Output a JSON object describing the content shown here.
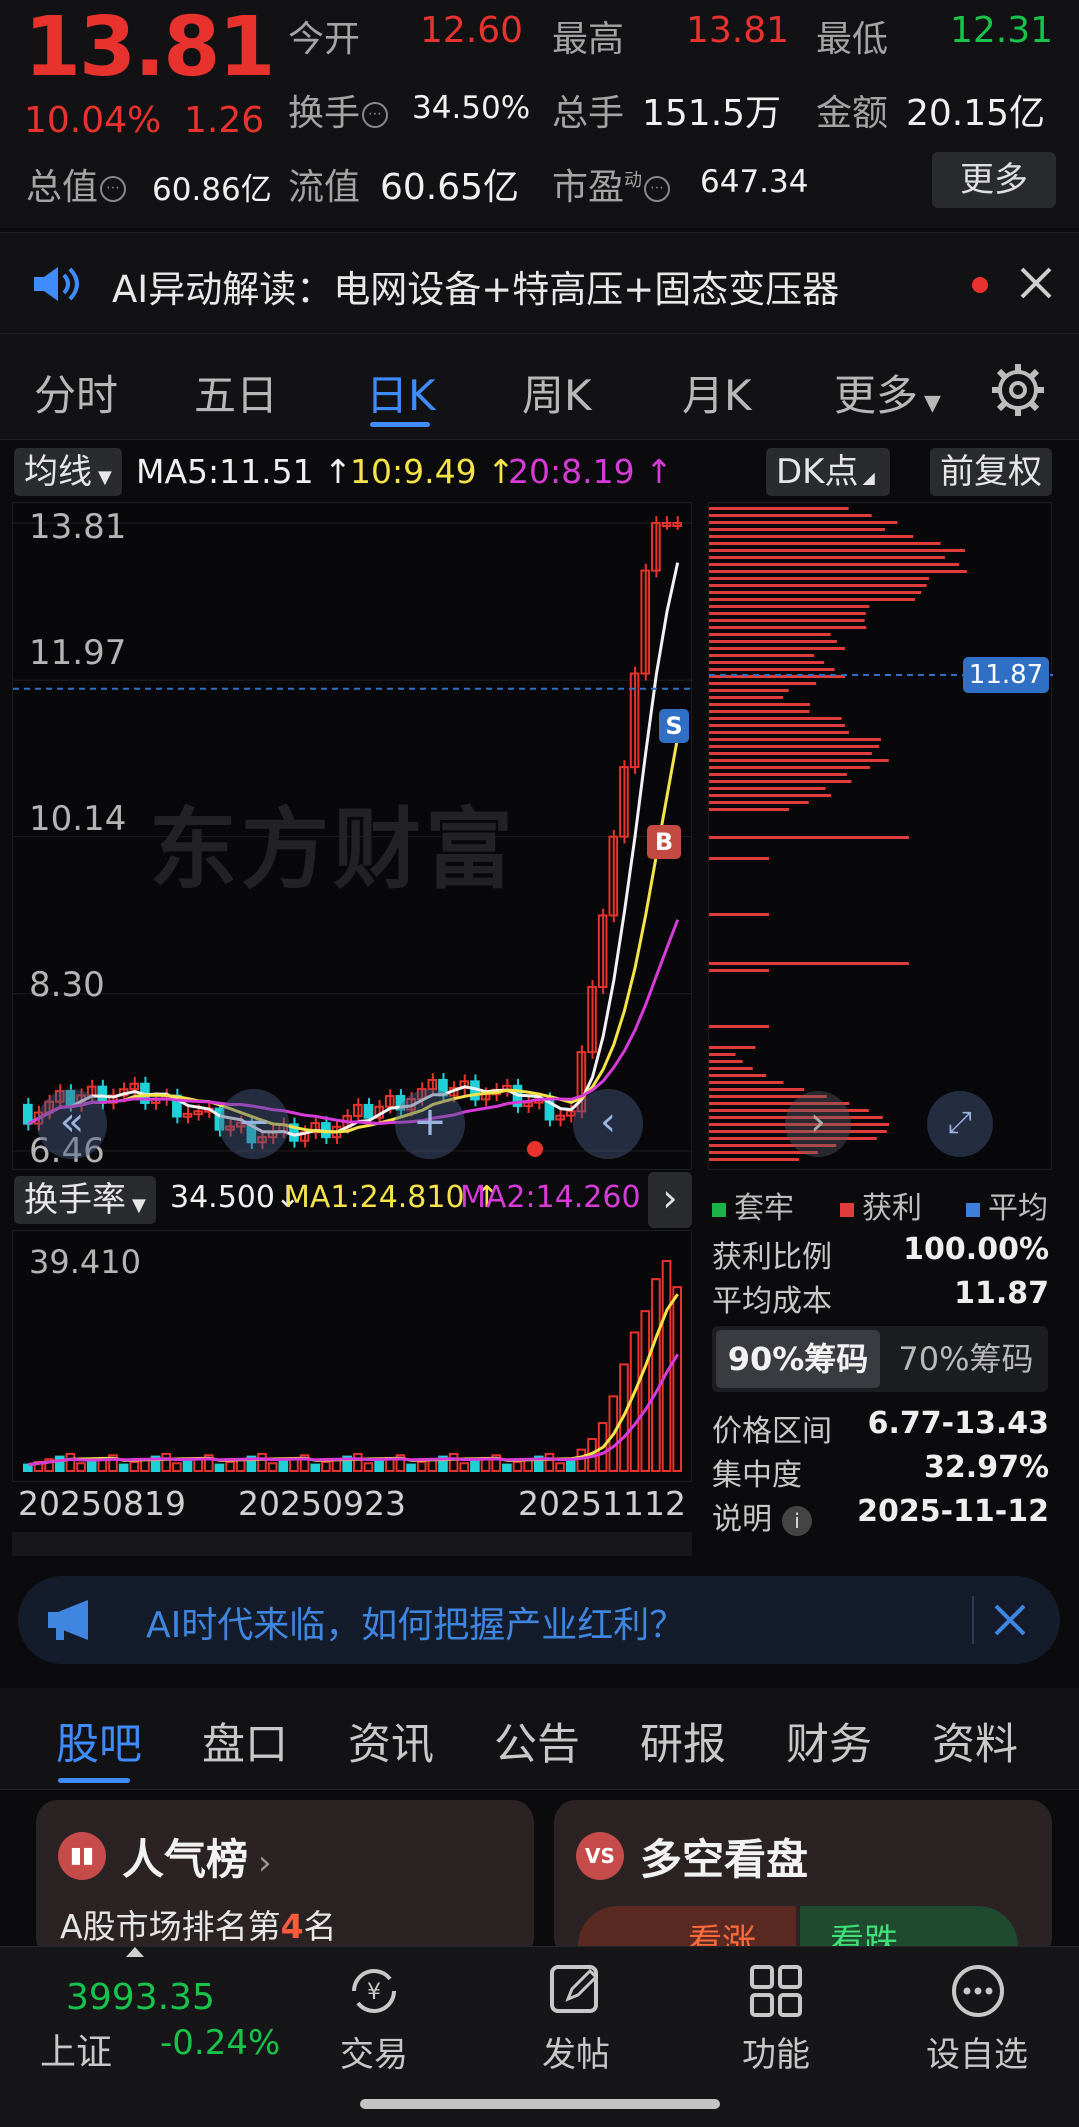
{
  "quote": {
    "price": "13.81",
    "change_pct": "10.04%",
    "change_amt": "1.26",
    "open_label": "今开",
    "open": "12.60",
    "high_label": "最高",
    "high": "13.81",
    "low_label": "最低",
    "low": "12.31",
    "turnover_label": "换手",
    "turnover": "34.50%",
    "volume_label": "总手",
    "volume": "151.5万",
    "amount_label": "金额",
    "amount": "20.15亿",
    "mktcap_label": "总值",
    "mktcap": "60.86亿",
    "float_label": "流值",
    "float_cap": "60.65亿",
    "pe_label": "市盈",
    "pe_sup": "动",
    "pe": "647.34",
    "more": "更多"
  },
  "ai_bar": {
    "text": "AI异动解读：电网设备+特高压+固态变压器"
  },
  "tabs": [
    {
      "label": "分时"
    },
    {
      "label": "五日"
    },
    {
      "label": "日K"
    },
    {
      "label": "周K"
    },
    {
      "label": "月K"
    },
    {
      "label": "更多"
    }
  ],
  "indicators": {
    "ma_select": "均线",
    "ma5": "MA5:11.51",
    "ma10": "10:9.49",
    "ma20": "20:8.19",
    "dk": "DK点",
    "adjust": "前复权",
    "turn_select": "换手率",
    "turn_val": "34.500",
    "turn_ma1": "MA1:24.810",
    "turn_ma2": "MA2:14.260"
  },
  "kchart": {
    "y_labels": [
      "13.81",
      "11.97",
      "10.14",
      "8.30",
      "6.46"
    ],
    "cost_tag": "11.87",
    "marker_s": "S",
    "marker_b": "B",
    "watermark": "东方财富"
  },
  "volchart": {
    "y_max": "39.410"
  },
  "dates": [
    "20250819",
    "20250923",
    "20251112"
  ],
  "chips": {
    "legend": [
      "套牢",
      "获利",
      "平均"
    ],
    "legend_colors": [
      "#19b347",
      "#e03c3c",
      "#3f7fdc"
    ],
    "profit_ratio_label": "获利比例",
    "profit_ratio": "100.00%",
    "avg_cost_label": "平均成本",
    "avg_cost": "11.87",
    "seg_on": "90%筹码",
    "seg_off": "70%筹码",
    "range_label": "价格区间",
    "range": "6.77-13.43",
    "concentration_label": "集中度",
    "concentration": "32.97%",
    "note_label": "说明",
    "note": "2025-11-12"
  },
  "banner": {
    "text": "AI时代来临，如何把握产业红利？"
  },
  "bottom_tabs": [
    {
      "label": "股吧"
    },
    {
      "label": "盘口"
    },
    {
      "label": "资讯"
    },
    {
      "label": "公告"
    },
    {
      "label": "研报"
    },
    {
      "label": "财务"
    },
    {
      "label": "资料"
    }
  ],
  "cards": {
    "popular_title": "人气榜",
    "popular_sub_prefix": "A股市场排名第",
    "popular_rank": "4",
    "popular_sub_suffix": "名",
    "longshort_title": "多空看盘",
    "rise": "看涨",
    "fall": "看跌"
  },
  "bottom_nav": {
    "index_value": "3993.35",
    "index_name": "上证",
    "index_chg": "-0.24%",
    "items": [
      {
        "label": "交易"
      },
      {
        "label": "发帖"
      },
      {
        "label": "功能"
      },
      {
        "label": "设自选"
      }
    ]
  }
}
